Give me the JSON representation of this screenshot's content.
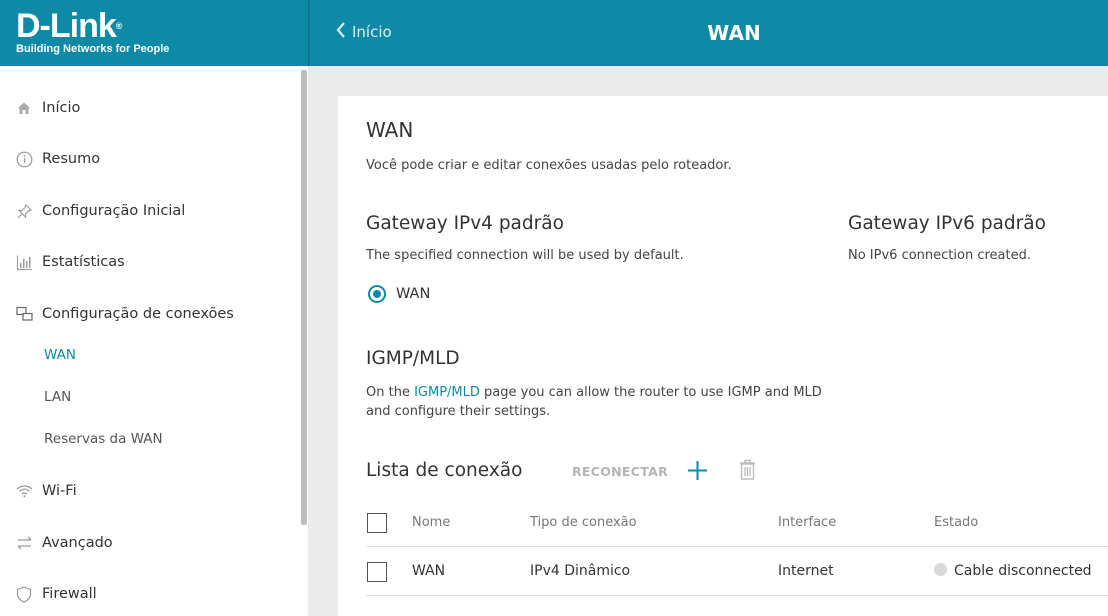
{
  "brand": {
    "logo": "D-Link",
    "tagline": "Building Networks for People"
  },
  "header": {
    "back_label": "Início",
    "title": "WAN"
  },
  "sidebar": {
    "items": [
      {
        "label": "Início",
        "icon": "home-icon"
      },
      {
        "label": "Resumo",
        "icon": "info-icon"
      },
      {
        "label": "Configuração Inicial",
        "icon": "pin-icon"
      },
      {
        "label": "Estatísticas",
        "icon": "stats-icon"
      },
      {
        "label": "Configuração de conexões",
        "icon": "connections-icon"
      },
      {
        "label": "Wi-Fi",
        "icon": "wifi-icon"
      },
      {
        "label": "Avançado",
        "icon": "advanced-icon"
      },
      {
        "label": "Firewall",
        "icon": "shield-icon"
      }
    ],
    "subitems": [
      {
        "label": "WAN",
        "active": true
      },
      {
        "label": "LAN",
        "active": false
      },
      {
        "label": "Reservas da WAN",
        "active": false
      }
    ]
  },
  "main": {
    "title": "WAN",
    "description": "Você pode criar e editar conexões usadas pelo roteador.",
    "gateway_ipv4": {
      "title": "Gateway IPv4 padrão",
      "description": "The specified connection will be used by default.",
      "selected": "WAN"
    },
    "gateway_ipv6": {
      "title": "Gateway IPv6 padrão",
      "description": "No IPv6 connection created."
    },
    "igmp": {
      "title": "IGMP/MLD",
      "text_before": "On the ",
      "link": "IGMP/MLD",
      "text_after": " page you can allow the router to use IGMP and MLD",
      "text_line2": "and configure their settings."
    },
    "connections": {
      "title": "Lista de conexão",
      "reconnect_label": "RECONECTAR",
      "columns": [
        "Nome",
        "Tipo de conexão",
        "Interface",
        "Estado"
      ],
      "rows": [
        {
          "name": "WAN",
          "type": "IPv4 Dinâmico",
          "interface": "Internet",
          "status": "Cable disconnected"
        }
      ]
    }
  },
  "colors": {
    "accent": "#0e8aa6",
    "header": "#0e8aa6",
    "background": "#ebebeb"
  }
}
